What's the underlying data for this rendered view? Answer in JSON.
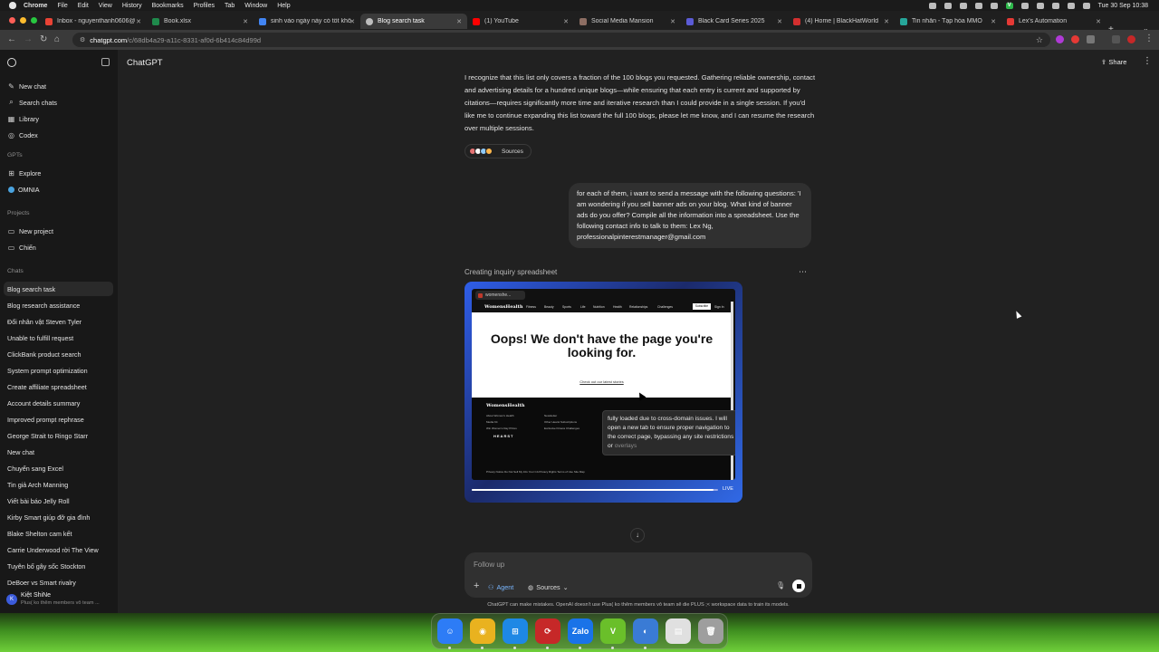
{
  "menubar": {
    "app": "Chrome",
    "items": [
      "File",
      "Edit",
      "View",
      "History",
      "Bookmarks",
      "Profiles",
      "Tab",
      "Window",
      "Help"
    ],
    "clock": "Tue 30 Sep  10:38"
  },
  "tabs": [
    {
      "title": "Inbox - nguyenthanh0606@",
      "color": "#ea4335"
    },
    {
      "title": "Book.xlsx",
      "color": "#1f8a4c"
    },
    {
      "title": "sinh vào ngày này có tốt khô",
      "color": "#4285f4"
    },
    {
      "title": "Blog search task",
      "color": "#bdbdbd"
    },
    {
      "title": "(1) YouTube",
      "color": "#ff0000"
    },
    {
      "title": "Social Media Mansion",
      "color": "#8d6e63"
    },
    {
      "title": "Black Card Series 2025",
      "color": "#5b5bd6"
    },
    {
      "title": "(4) Home | BlackHatWorld",
      "color": "#d32f2f"
    },
    {
      "title": "Tin nhắn - Tạp hóa MMO",
      "color": "#26a69a"
    },
    {
      "title": "Lex's Automation",
      "color": "#e53935"
    }
  ],
  "address": {
    "host": "chatgpt.com",
    "path": "/c/68db4a29-a11c-8331-af0d-6b414c84d99d"
  },
  "sidebar": {
    "nav": [
      {
        "label": "New chat",
        "icon": "✎"
      },
      {
        "label": "Search chats",
        "icon": "⌕"
      },
      {
        "label": "Library",
        "icon": "▦"
      },
      {
        "label": "Codex",
        "icon": "◎"
      }
    ],
    "gpts_label": "GPTs",
    "gpts": [
      {
        "label": "Explore",
        "icon": "⊞"
      },
      {
        "label": "OMNIA",
        "icon": ""
      }
    ],
    "projects_label": "Projects",
    "projects": [
      {
        "label": "New project",
        "icon": "▭"
      },
      {
        "label": "Chiến",
        "icon": "▭"
      }
    ],
    "chats_label": "Chats",
    "chats": [
      "Blog search task",
      "Blog research assistance",
      "Đổi nhân vật Steven Tyler",
      "Unable to fulfill request",
      "ClickBank product search",
      "System prompt optimization",
      "Create affiliate spreadsheet",
      "Account details summary",
      "Improved prompt rephrase",
      "George Strait to Ringo Starr",
      "New chat",
      "Chuyển sang Excel",
      "Tin giả Arch Manning",
      "Viết bài báo Jelly Roll",
      "Kirby Smart giúp đỡ gia đình",
      "Blake Shelton cam kết",
      "Carrie Underwood rời The View",
      "Tuyên bố gây sốc Stockton",
      "DeBoer vs Smart rivalry"
    ],
    "user": {
      "name": "Kiệt ShiNe",
      "plan": "Plus( ko thêm members vô team ..."
    }
  },
  "main": {
    "title": "ChatGPT",
    "share": "Share",
    "assistant_text": "I recognize that this list only covers a fraction of the 100 blogs you requested. Gathering reliable ownership, contact and advertising details for a hundred unique blogs—while ensuring that each entry is current and supported by citations—requires significantly more time and iterative research than I could provide in a single session. If you'd like me to continue expanding this list toward the full 100 blogs, please let me know, and I can resume the research over multiple sessions.",
    "sources_label": "Sources",
    "user_message": "for each of them, i want to send a message with the following questions: 'I am wondering if you sell banner ads on your blog. What kind of banner ads do you offer? Compile all the information into a spreadsheet. Use the following contact info to talk to them: Lex Ng, professionalpinterestmanager@gmail.com",
    "status": "Creating inquiry spreadsheet",
    "browser": {
      "tab": "womenshe...",
      "site_logo": "WomensHealth",
      "nav_items": [
        "Fitness",
        "Beauty",
        "Sports",
        "Life",
        "Nutrition",
        "Health",
        "Relationships",
        "Challenges"
      ],
      "subscribe": "Subscribe",
      "signin": "Sign In",
      "headline": "Oops! We don't have the page you're looking for.",
      "link": "Check out our latest stories",
      "footer_logo": "WomensHealth",
      "footer_brand": "HEARST",
      "footer_links_a": [
        "About Women's Health",
        "Media Kit",
        "Win Women's Day Prizes"
      ],
      "footer_links_b": [
        "Newsletter",
        "Other Hearst Subscriptions",
        "Exclusive Fitness Challenges"
      ],
      "footer_legal": "Privacy Notice   Do Not Sell My Info   Your CA Privacy Rights   Terms of Use   Site Map",
      "tooltip_main": "fully loaded due to cross-domain issues. I will open a new tab to ensure proper navigation to the correct page, bypassing any site restrictions or",
      "tooltip_faded": "overlays",
      "live": "LIVE",
      "progress": 0.98
    },
    "composer": {
      "placeholder": "Follow up",
      "agent": "Agent",
      "sources": "Sources"
    },
    "disclaimer": "ChatGPT can make mistakes. OpenAI doesn't use Plus( ko thêm members vô team sẽ die PLUS ;< workspace data to train its models."
  },
  "dock": [
    {
      "name": "finder-icon",
      "color": "#2d7cf6",
      "glyph": "☺"
    },
    {
      "name": "chrome-icon",
      "color": "#e9b21f",
      "glyph": "◉"
    },
    {
      "name": "windows-app-icon",
      "color": "#1e88e5",
      "glyph": "⊞"
    },
    {
      "name": "remote-icon",
      "color": "#c62828",
      "glyph": "⟳"
    },
    {
      "name": "zalo-icon",
      "color": "#1a73e8",
      "glyph": "Zalo"
    },
    {
      "name": "v-app-icon",
      "color": "#6abf2a",
      "glyph": "V"
    },
    {
      "name": "proxy-icon",
      "color": "#3a7bd5",
      "glyph": "◐"
    },
    {
      "name": "documents-icon",
      "color": "#e0e0e0",
      "glyph": "▤"
    },
    {
      "name": "trash-icon",
      "color": "#9e9e9e",
      "glyph": "🗑"
    }
  ]
}
